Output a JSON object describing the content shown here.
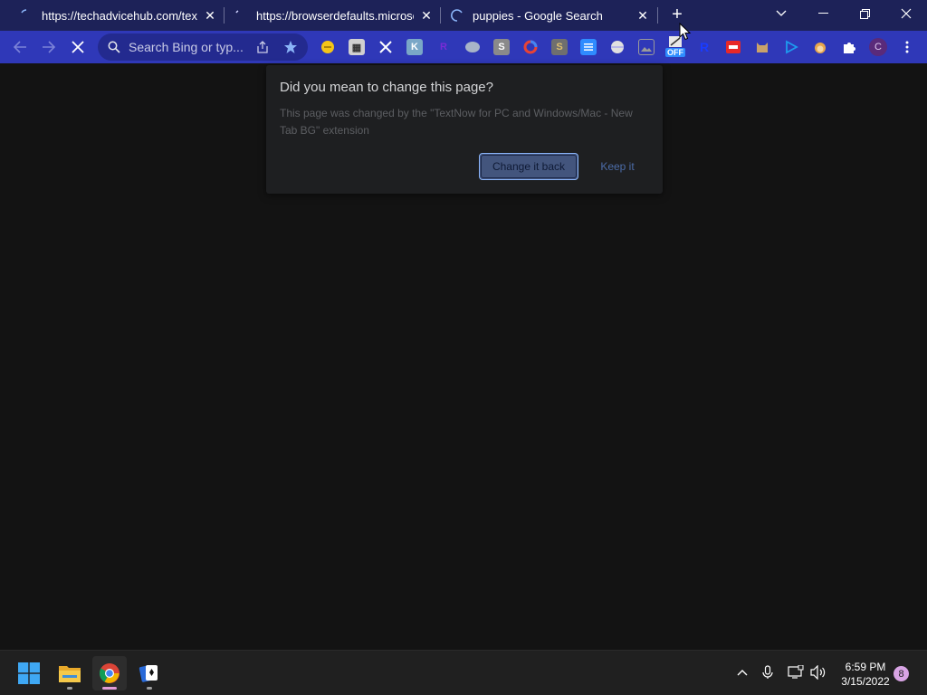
{
  "tabs": [
    {
      "title": "https://techadvicehub.com/textn",
      "loading": true
    },
    {
      "title": "https://browserdefaults.microsoft",
      "loading": true
    },
    {
      "title": "puppies - Google Search",
      "loading": true
    }
  ],
  "window_controls": [
    "tab-search",
    "minimize",
    "restore",
    "close"
  ],
  "omnibox": {
    "placeholder": "Search Bing or typ..."
  },
  "extensions": [
    {
      "name": "emoji-face-icon",
      "color": "#f5c518"
    },
    {
      "name": "pixel-image-icon",
      "color": "#d0d0d0"
    },
    {
      "name": "cross-arrows-icon",
      "color": "#ffffff"
    },
    {
      "name": "k-extension-icon",
      "label": "K",
      "color": "#7aa7c7"
    },
    {
      "name": "r-purple-icon",
      "label": "R",
      "color": "#7a2bd6"
    },
    {
      "name": "elephant-icon",
      "color": "#a8b4c8"
    },
    {
      "name": "s-extension-icon",
      "label": "S",
      "color": "#8a8a8a"
    },
    {
      "name": "colorful-ring-icon",
      "color": "#e84335"
    },
    {
      "name": "s-box-icon",
      "label": "S",
      "color": "#6f6f6f"
    },
    {
      "name": "grid-dots-icon",
      "color": "#2f8cff"
    },
    {
      "name": "white-circle-icon",
      "color": "#e0e0e0"
    },
    {
      "name": "picture-icon",
      "color": "#9a9a9a"
    },
    {
      "name": "off-badge-icon",
      "label": "OFF",
      "color": "#2f8cff"
    },
    {
      "name": "r-blue-icon",
      "label": "R",
      "color": "#1a3cff"
    },
    {
      "name": "red-box-icon",
      "color": "#e82828"
    },
    {
      "name": "cat-icon",
      "color": "#c9a26a"
    },
    {
      "name": "play-icon",
      "color": "#1d9bf0"
    },
    {
      "name": "monkey-icon",
      "color": "#e8a64b"
    },
    {
      "name": "puzzle-piece-icon",
      "color": "#ffffff"
    }
  ],
  "profile": {
    "initial": "C",
    "color": "#5a2a7a"
  },
  "dialog": {
    "title": "Did you mean to change this page?",
    "body": "This page was changed by the \"TextNow for PC and Windows/Mac - New Tab BG\" extension",
    "primary_button": "Change it back",
    "secondary_button": "Keep it"
  },
  "taskbar": {
    "apps": [
      "start-button",
      "file-explorer",
      "chrome",
      "solitaire"
    ],
    "time": "6:59 PM",
    "date": "3/15/2022",
    "notification_count": "8"
  }
}
